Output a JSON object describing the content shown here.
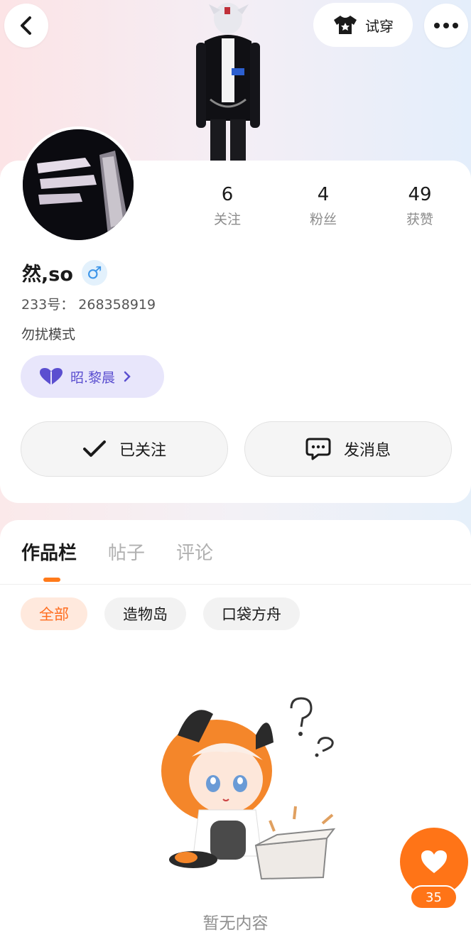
{
  "header": {
    "tryon_label": "试穿"
  },
  "profile": {
    "username": "然,so",
    "gender_symbol": "♂",
    "uid": "233号： 268358919",
    "bio": "勿扰模式",
    "relation_pill": "昭.黎晨"
  },
  "stats": [
    {
      "value": "6",
      "label": "关注"
    },
    {
      "value": "4",
      "label": "粉丝"
    },
    {
      "value": "49",
      "label": "获赞"
    }
  ],
  "actions": {
    "follow_label": "已关注",
    "message_label": "发消息"
  },
  "tabs": [
    {
      "label": "作品栏",
      "active": true
    },
    {
      "label": "帖子",
      "active": false
    },
    {
      "label": "评论",
      "active": false
    }
  ],
  "chips": [
    {
      "label": "全部",
      "active": true
    },
    {
      "label": "造物岛",
      "active": false
    },
    {
      "label": "口袋方舟",
      "active": false
    }
  ],
  "empty_state": {
    "text": "暂无内容"
  },
  "like_fab": {
    "count": "35"
  },
  "colors": {
    "accent": "#ff7417",
    "pill_bg": "#e8e6fb",
    "pill_text": "#5b4fd0",
    "gender_blue": "#3d95e8"
  }
}
